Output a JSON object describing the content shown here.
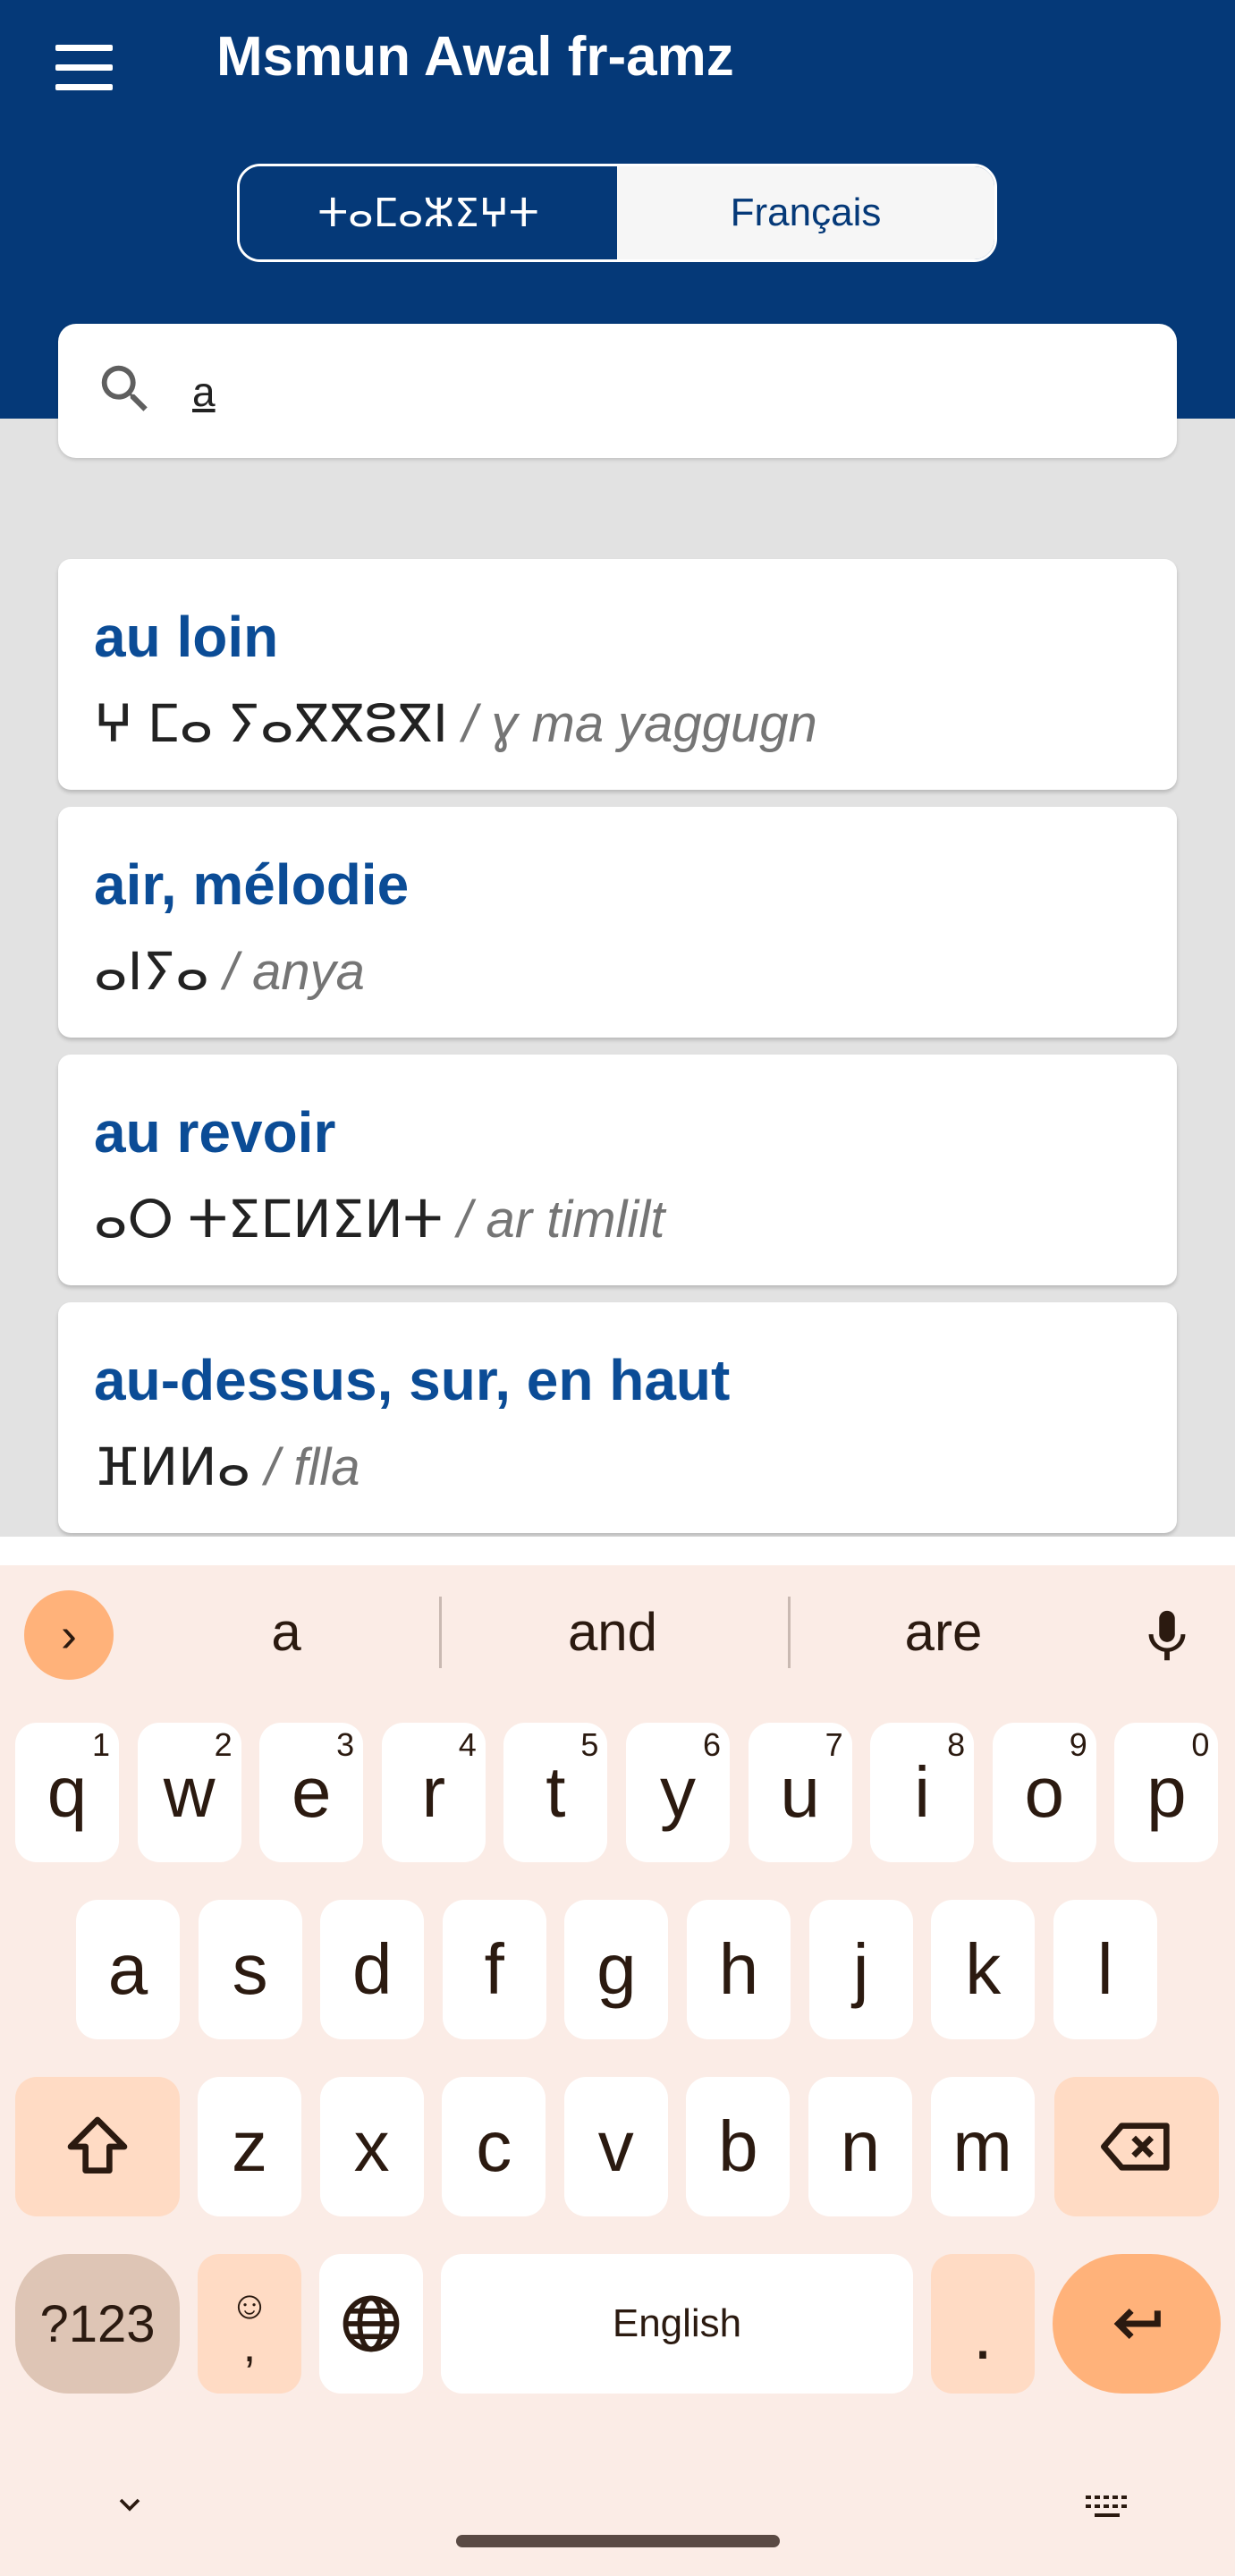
{
  "app": {
    "title": "Msmun Awal fr-amz",
    "menu_icon": "hamburger-menu-icon"
  },
  "language_toggle": {
    "options": [
      {
        "label": "ⵜⴰⵎⴰⵣⵉⵖⵜ",
        "active": true
      },
      {
        "label": "Français",
        "active": false
      }
    ]
  },
  "search": {
    "icon": "search-icon",
    "value": "a",
    "placeholder": ""
  },
  "results": [
    {
      "french": "au loin",
      "tifinagh": "ⵖ ⵎⴰ ⵢⴰⴳⴳⵓⴳⵏ",
      "latin": " / ɣ ma yaggugn"
    },
    {
      "french": "air, mélodie",
      "tifinagh": "ⴰⵏⵢⴰ",
      "latin": " / anya"
    },
    {
      "french": "au revoir",
      "tifinagh": "ⴰⵔ ⵜⵉⵎⵍⵉⵍⵜ",
      "latin": " / ar timlilt"
    },
    {
      "french": "au-dessus, sur, en haut",
      "tifinagh": "ⴼⵍⵍⴰ",
      "latin": " / flla"
    }
  ],
  "keyboard": {
    "suggestions": [
      "a",
      "and",
      "are"
    ],
    "row1": [
      {
        "k": "q",
        "s": "1"
      },
      {
        "k": "w",
        "s": "2"
      },
      {
        "k": "e",
        "s": "3"
      },
      {
        "k": "r",
        "s": "4"
      },
      {
        "k": "t",
        "s": "5"
      },
      {
        "k": "y",
        "s": "6"
      },
      {
        "k": "u",
        "s": "7"
      },
      {
        "k": "i",
        "s": "8"
      },
      {
        "k": "o",
        "s": "9"
      },
      {
        "k": "p",
        "s": "0"
      }
    ],
    "row2": [
      "a",
      "s",
      "d",
      "f",
      "g",
      "h",
      "j",
      "k",
      "l"
    ],
    "row3": [
      "z",
      "x",
      "c",
      "v",
      "b",
      "n",
      "m"
    ],
    "symbols_label": "?123",
    "emoji_label": "☺",
    "comma_label": ",",
    "space_label": "English",
    "period_label": ".",
    "shift_icon": "shift-icon",
    "backspace_icon": "backspace-icon",
    "enter_icon": "enter-icon",
    "globe_icon": "globe-icon",
    "mic_icon": "microphone-icon"
  },
  "colors": {
    "primary": "#053978",
    "link_blue": "#0b4c96",
    "keyboard_bg": "#fbece6",
    "accent_orange": "#ffb27a"
  }
}
